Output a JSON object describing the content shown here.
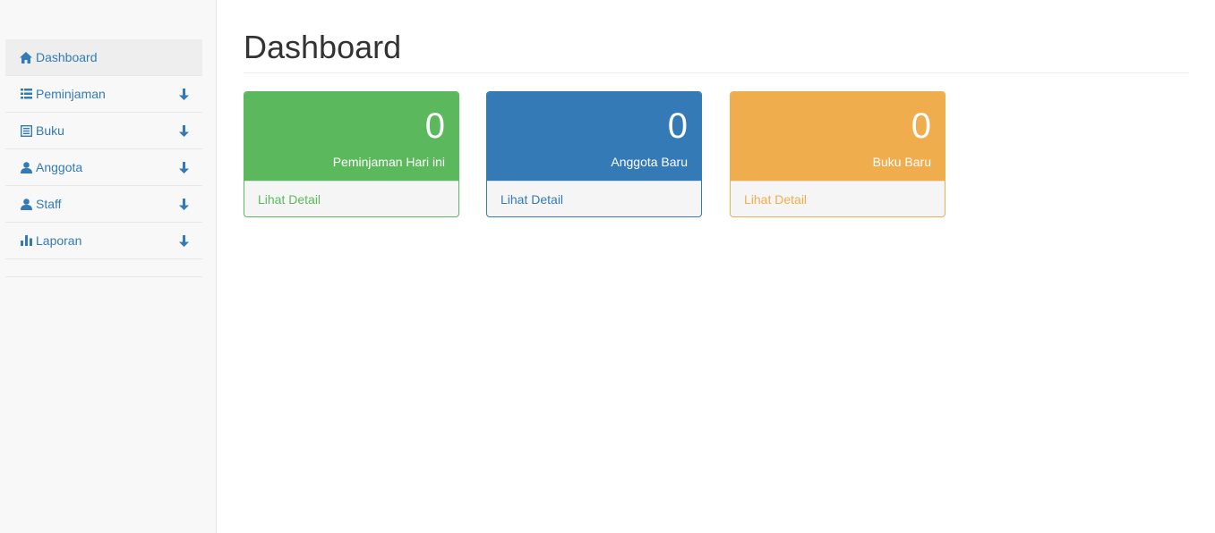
{
  "sidebar": {
    "items": [
      {
        "label": "Dashboard",
        "icon": "home-icon",
        "active": true
      },
      {
        "label": "Peminjaman",
        "icon": "list-icon"
      },
      {
        "label": "Buku",
        "icon": "book-list-icon"
      },
      {
        "label": "Anggota",
        "icon": "user-icon"
      },
      {
        "label": "Staff",
        "icon": "user-icon"
      },
      {
        "label": "Laporan",
        "icon": "bar-chart-icon"
      }
    ]
  },
  "main": {
    "title": "Dashboard",
    "panels": [
      {
        "count": "0",
        "caption": "Peminjaman Hari ini",
        "link": "Lihat Detail",
        "color": "#5cb85c"
      },
      {
        "count": "0",
        "caption": "Anggota Baru",
        "link": "Lihat Detail",
        "color": "#337ab7"
      },
      {
        "count": "0",
        "caption": "Buku Baru",
        "link": "Lihat Detail",
        "color": "#f0ad4e"
      }
    ]
  },
  "colors": {
    "link": "#337ab7",
    "sidebar_bg": "#f8f8f8",
    "active_bg": "#eeeeee"
  }
}
